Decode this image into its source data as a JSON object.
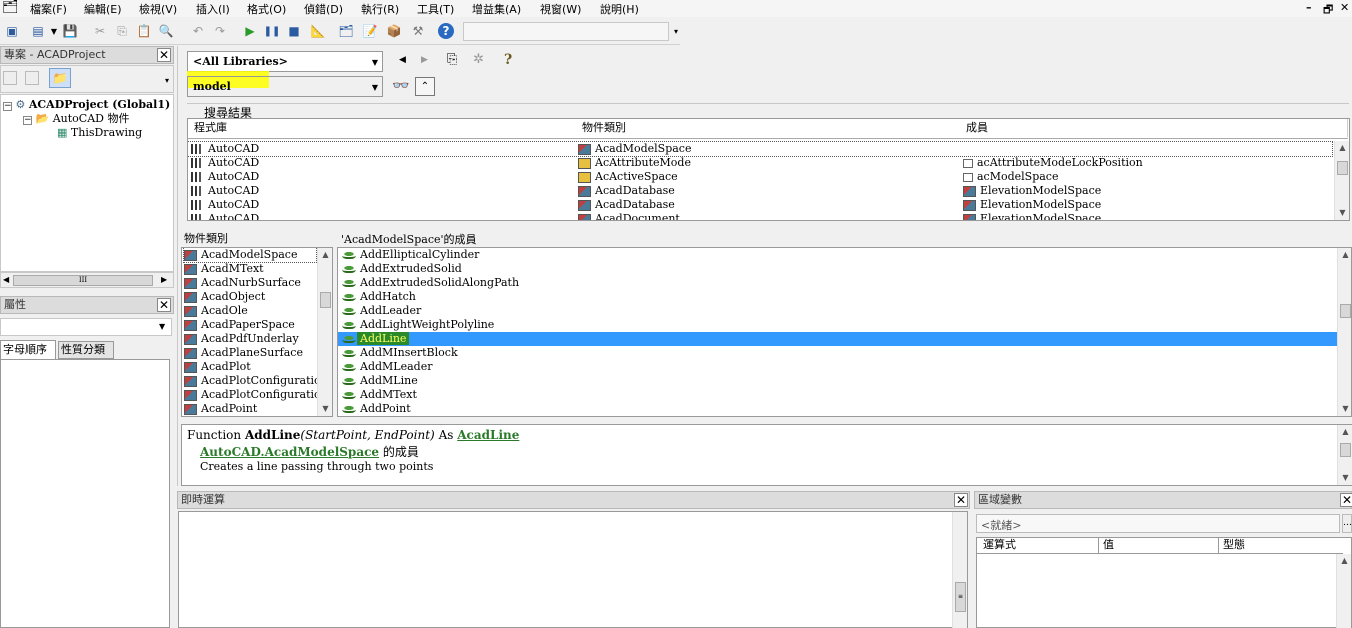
{
  "menu": {
    "items": [
      "檔案(F)",
      "編輯(E)",
      "檢視(V)",
      "插入(I)",
      "格式(O)",
      "偵錯(D)",
      "執行(R)",
      "工具(T)",
      "增益集(A)",
      "視窗(W)",
      "說明(H)"
    ]
  },
  "project": {
    "header": "專案 - ACADProject",
    "root": "ACADProject (Global1)",
    "folder": "AutoCAD 物件",
    "leaf": "ThisDrawing"
  },
  "properties": {
    "header": "屬性",
    "tab_alpha": "字母順序",
    "tab_category": "性質分類"
  },
  "browser": {
    "library_select": "<All Libraries>",
    "search_value": "model",
    "search_results_label": "搜尋結果",
    "results_headers": [
      "程式庫",
      "物件類別",
      "成員"
    ],
    "results": [
      {
        "lib": "AutoCAD",
        "cls": "AcadModelSpace",
        "cls_icon": "class-icon",
        "member": "",
        "member_icon": ""
      },
      {
        "lib": "AutoCAD",
        "cls": "AcAttributeMode",
        "cls_icon": "enum-icon",
        "member": "acAttributeModeLockPosition",
        "member_icon": "constant-icon"
      },
      {
        "lib": "AutoCAD",
        "cls": "AcActiveSpace",
        "cls_icon": "enum-icon",
        "member": "acModelSpace",
        "member_icon": "constant-icon"
      },
      {
        "lib": "AutoCAD",
        "cls": "AcadDatabase",
        "cls_icon": "class-icon",
        "member": "ElevationModelSpace",
        "member_icon": "property-icon"
      },
      {
        "lib": "AutoCAD",
        "cls": "AcadDatabase",
        "cls_icon": "class-icon",
        "member": "ElevationModelSpace",
        "member_icon": "property-icon"
      },
      {
        "lib": "AutoCAD",
        "cls": "AcadDocument",
        "cls_icon": "class-icon",
        "member": "ElevationModelSpace",
        "member_icon": "property-icon"
      }
    ],
    "classes_header": "物件類別",
    "classes": [
      "AcadModelSpace",
      "AcadMText",
      "AcadNurbSurface",
      "AcadObject",
      "AcadOle",
      "AcadPaperSpace",
      "AcadPdfUnderlay",
      "AcadPlaneSurface",
      "AcadPlot",
      "AcadPlotConfiguration",
      "AcadPlotConfigurations",
      "AcadPoint"
    ],
    "members_header": "'AcadModelSpace'的成員",
    "members": [
      "AddEllipticalCylinder",
      "AddExtrudedSolid",
      "AddExtrudedSolidAlongPath",
      "AddHatch",
      "AddLeader",
      "AddLightWeightPolyline",
      "AddLine",
      "AddMInsertBlock",
      "AddMLeader",
      "AddMLine",
      "AddMText",
      "AddPoint"
    ],
    "selected_member": "AddLine",
    "detail": {
      "prefix": "Function",
      "name": "AddLine",
      "params": "(StartPoint, EndPoint)",
      "as": "As",
      "return_type": "AcadLine",
      "lib_link": "AutoCAD",
      "class_link": "AcadModelSpace",
      "member_of": "的成員",
      "description": "Creates a line passing through two points"
    }
  },
  "immediate": {
    "header": "即時運算"
  },
  "locals": {
    "header": "區域變數",
    "status": "<就緒>",
    "columns": [
      "運算式",
      "值",
      "型態"
    ]
  },
  "colors": {
    "highlight_yellow": "#ffff00",
    "selection_blue": "#3399ff",
    "link_green": "#2a7a2a"
  }
}
